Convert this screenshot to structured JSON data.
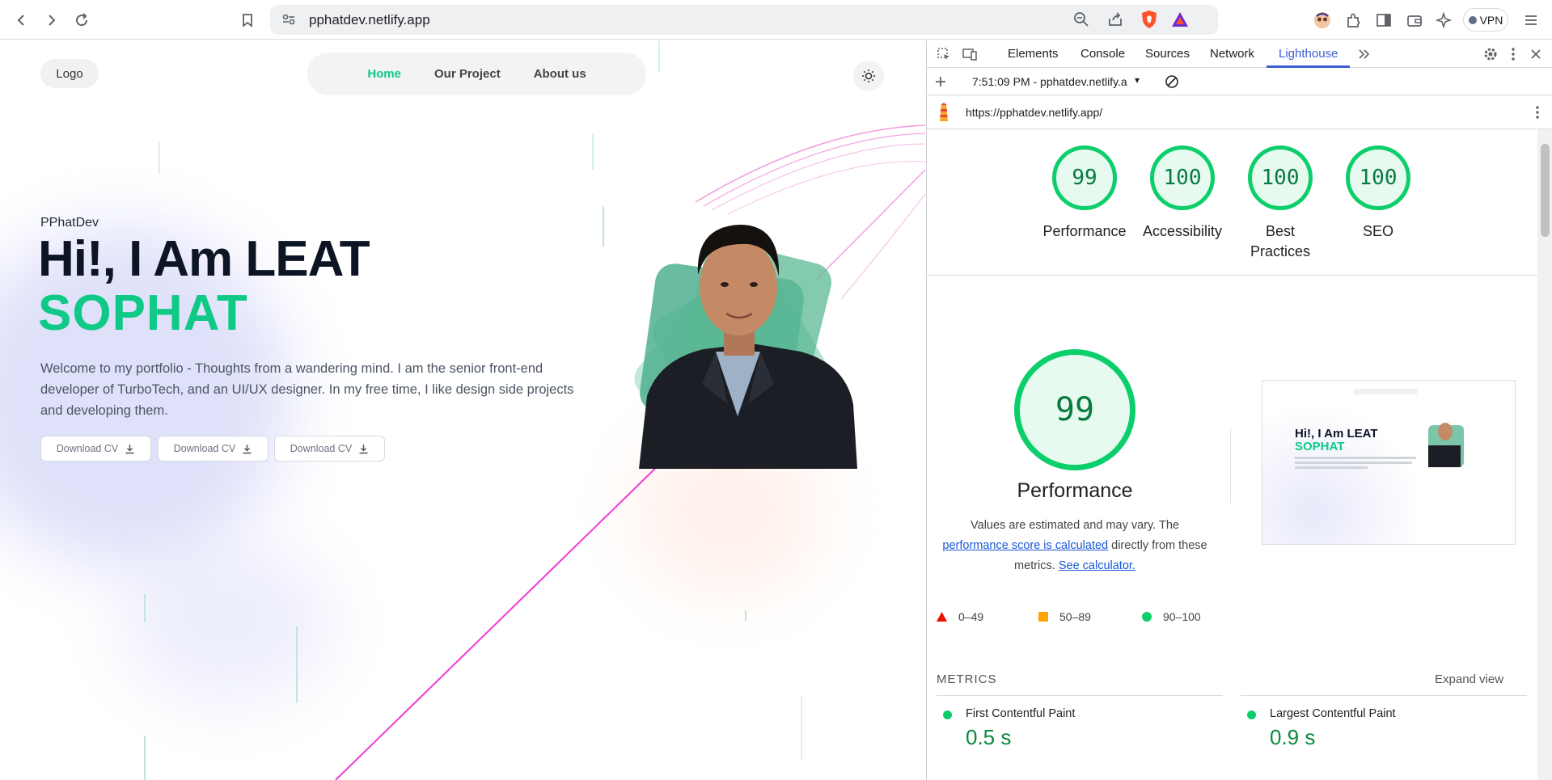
{
  "browser": {
    "url": "pphatdev.netlify.app",
    "vpn_label": "VPN"
  },
  "page": {
    "logo_label": "Logo",
    "nav": {
      "home": "Home",
      "project": "Our Project",
      "about": "About us"
    },
    "brand": "PPhatDev",
    "headline_1": "Hi!, I Am LEAT",
    "headline_2": "SOPHAT",
    "intro": "Welcome to my portfolio - Thoughts from a wandering mind. I am the senior front-end developer of TurboTech, and an UI/UX designer. In my free time, I like design side projects and developing them.",
    "cv_buttons": [
      "Download CV",
      "Download CV",
      "Download CV"
    ],
    "accent_color": "#10c987"
  },
  "devtools": {
    "tabs": [
      "Elements",
      "Console",
      "Sources",
      "Network",
      "Lighthouse"
    ],
    "active_tab": "Lighthouse",
    "report_label": "7:51:09 PM - pphatdev.netlify.a",
    "report_url": "https://pphatdev.netlify.app/",
    "scores": [
      {
        "value": "99",
        "label": "Performance"
      },
      {
        "value": "100",
        "label": "Accessibility"
      },
      {
        "value": "100",
        "label": "Best Practices"
      },
      {
        "value": "100",
        "label": "SEO"
      }
    ],
    "perf_score": "99",
    "perf_title": "Performance",
    "note_1": "Values are estimated and may vary. The",
    "note_link_1": "performance score is calculated",
    "note_2": "directly from these metrics.",
    "note_link_2": "See calculator.",
    "legend": [
      "0–49",
      "50–89",
      "90–100"
    ],
    "metrics_header": "METRICS",
    "expand_label": "Expand view",
    "metrics": [
      {
        "name": "First Contentful Paint",
        "value": "0.5 s"
      },
      {
        "name": "Largest Contentful Paint",
        "value": "0.9 s"
      }
    ],
    "thumb": {
      "h1": "Hi!, I Am LEAT",
      "h2": "SOPHAT"
    },
    "colors": {
      "pass": "#0cce6b",
      "average": "#ffa400",
      "fail": "#ff4e42"
    }
  }
}
